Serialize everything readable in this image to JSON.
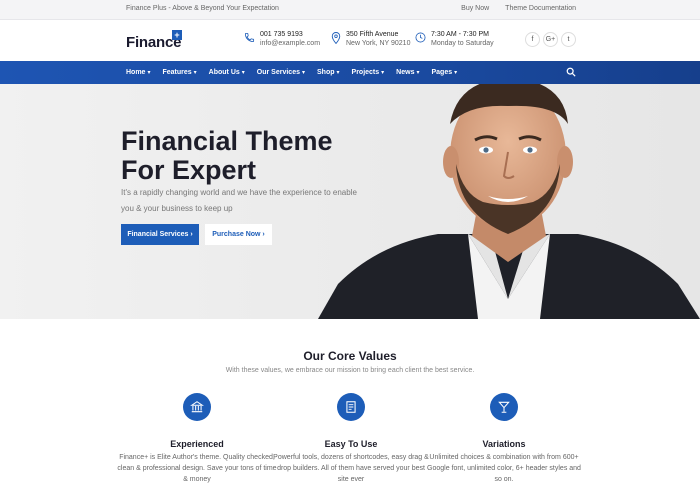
{
  "topbar": {
    "tagline": "Finance Plus - Above & Beyond Your Expectation",
    "links": [
      "Buy Now",
      "Theme Documentation"
    ]
  },
  "header": {
    "logo_text": "Finance",
    "logo_plus": "+",
    "phone": {
      "line1": "001 735 9193",
      "line2": "info@example.com"
    },
    "address": {
      "line1": "350 Fifth Avenue",
      "line2": "New York, NY 90210"
    },
    "hours": {
      "line1": "7:30 AM - 7:30 PM",
      "line2": "Monday to Saturday"
    },
    "social": [
      "f",
      "G+",
      "t"
    ]
  },
  "nav": {
    "items": [
      "Home",
      "Features",
      "About Us",
      "Our Services",
      "Shop",
      "Projects",
      "News",
      "Pages"
    ],
    "caret": "▾"
  },
  "hero": {
    "title": "Financial Theme For Expert",
    "subtitle": "It's a rapidly changing world and we have the experience to enable you & your business to keep up",
    "primary_button": "Financial Services ›",
    "secondary_button": "Purchase Now ›"
  },
  "core_values": {
    "title": "Our Core Values",
    "subtitle": "With these values, we embrace our mission to bring each client the best service.",
    "items": [
      {
        "icon": "bank-icon",
        "title": "Experienced",
        "text": "Finance+ is Elite Author's theme. Quality checked, clean & professional design. Save your tons of time & money"
      },
      {
        "icon": "document-icon",
        "title": "Easy To Use",
        "text": "Powerful tools, dozens of shortcodes, easy drag & drop builders. All of them have served your best site ever"
      },
      {
        "icon": "cocktail-icon",
        "title": "Variations",
        "text": "Unlimited choices & combination with from 600+ Google font, unlimited color, 6+ header styles and so on."
      }
    ]
  },
  "colors": {
    "accent": "#1d5db8",
    "nav": "#1e55b3"
  }
}
